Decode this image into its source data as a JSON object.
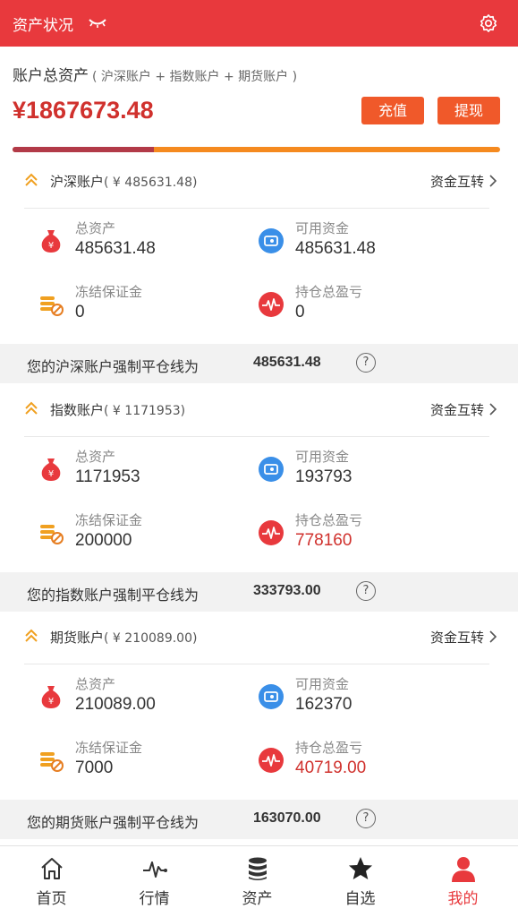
{
  "header": {
    "title": "资产状况",
    "icons": [
      "eye-closed-icon",
      "gear-icon"
    ]
  },
  "summary": {
    "label": "账户总资产",
    "sub_label": "( 沪深账户 + 指数账户 + 期货账户 )",
    "total": "¥1867673.48",
    "recharge_label": "充值",
    "withdraw_label": "提现",
    "colors": {
      "accent": "#e8393d",
      "button": "#f0592a",
      "progress_a": "#b23a48",
      "progress_b": "#f58a1f"
    },
    "progress_fraction": 0.29
  },
  "accounts": [
    {
      "name": "沪深账户",
      "amount": "( ¥ 485631.48)",
      "transfer": "资金互转",
      "total_assets_label": "总资产",
      "total_assets": "485631.48",
      "available_label": "可用资金",
      "available": "485631.48",
      "frozen_label": "冻结保证金",
      "frozen": "0",
      "pnl_label": "持仓总盈亏",
      "pnl": "0",
      "liquidation_text": "您的沪深账户强制平仓线为",
      "liquidation_value": "485631.48"
    },
    {
      "name": "指数账户",
      "amount": "( ¥ 1171953)",
      "transfer": "资金互转",
      "total_assets_label": "总资产",
      "total_assets": "1171953",
      "available_label": "可用资金",
      "available": "193793",
      "frozen_label": "冻结保证金",
      "frozen": "200000",
      "pnl_label": "持仓总盈亏",
      "pnl": "778160",
      "liquidation_text": "您的指数账户强制平仓线为",
      "liquidation_value": "333793.00"
    },
    {
      "name": "期货账户",
      "amount": "( ¥ 210089.00)",
      "transfer": "资金互转",
      "total_assets_label": "总资产",
      "total_assets": "210089.00",
      "available_label": "可用资金",
      "available": "162370",
      "frozen_label": "冻结保证金",
      "frozen": "7000",
      "pnl_label": "持仓总盈亏",
      "pnl": "40719.00",
      "liquidation_text": "您的期货账户强制平仓线为",
      "liquidation_value": "163070.00"
    }
  ],
  "help_glyph": "?",
  "tabs": [
    {
      "label": "首页",
      "icon": "home-icon"
    },
    {
      "label": "行情",
      "icon": "pulse-chart-icon"
    },
    {
      "label": "资产",
      "icon": "database-icon"
    },
    {
      "label": "自选",
      "icon": "star-icon"
    },
    {
      "label": "我的",
      "icon": "user-icon",
      "active": true
    }
  ]
}
